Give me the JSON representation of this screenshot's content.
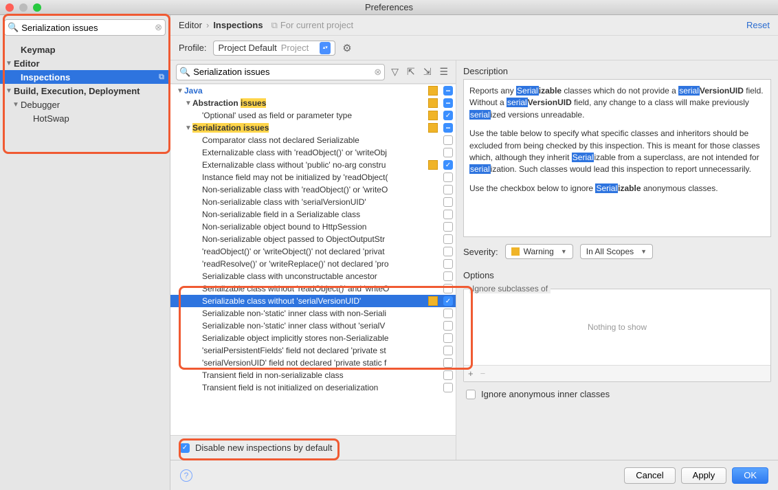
{
  "window": {
    "title": "Preferences"
  },
  "sidebar": {
    "search_value": "Serialization issues",
    "items": [
      {
        "label": "Keymap",
        "kind": "item",
        "level": 1,
        "bold": true
      },
      {
        "label": "Editor",
        "kind": "parent",
        "level": 0,
        "bold": true
      },
      {
        "label": "Inspections",
        "kind": "item",
        "level": 1,
        "bold": true,
        "selected": true
      },
      {
        "label": "Build, Execution, Deployment",
        "kind": "parent",
        "level": 0,
        "bold": true
      },
      {
        "label": "Debugger",
        "kind": "parent",
        "level": 1
      },
      {
        "label": "HotSwap",
        "kind": "item",
        "level": 2
      }
    ]
  },
  "breadcrumb": {
    "a": "Editor",
    "b": "Inspections",
    "note": "For current project",
    "reset": "Reset"
  },
  "profile": {
    "label": "Profile:",
    "value": "Project Default",
    "grey": "Project"
  },
  "tree": {
    "search_value": "Serialization issues",
    "rows": [
      {
        "label": "Java",
        "lvl": 0,
        "arrow": "down",
        "bold": true,
        "blue": true,
        "sev": true,
        "cb": "minus"
      },
      {
        "pre": "Abstraction ",
        "hl": "issues",
        "lvl": 1,
        "arrow": "down",
        "bold": true,
        "sev": true,
        "cb": "minus"
      },
      {
        "label": "'Optional' used as field or parameter type",
        "lvl": 2,
        "sev": true,
        "cb": "checked"
      },
      {
        "pre": "",
        "hl": "Serialization issues",
        "lvl": 1,
        "arrow": "down",
        "bold": true,
        "sev": true,
        "cb": "minus"
      },
      {
        "label": "Comparator class not declared Serializable",
        "lvl": 2,
        "cb": "empty"
      },
      {
        "label": "Externalizable class with 'readObject()' or 'writeObj",
        "lvl": 2,
        "cb": "empty"
      },
      {
        "label": "Externalizable class without 'public' no-arg constru",
        "lvl": 2,
        "sev": true,
        "cb": "checked"
      },
      {
        "label": "Instance field may not be initialized by 'readObject(",
        "lvl": 2,
        "cb": "empty"
      },
      {
        "label": "Non-serializable class with 'readObject()' or 'writeO",
        "lvl": 2,
        "cb": "empty"
      },
      {
        "label": "Non-serializable class with 'serialVersionUID'",
        "lvl": 2,
        "cb": "empty"
      },
      {
        "label": "Non-serializable field in a Serializable class",
        "lvl": 2,
        "cb": "empty"
      },
      {
        "label": "Non-serializable object bound to HttpSession",
        "lvl": 2,
        "cb": "empty"
      },
      {
        "label": "Non-serializable object passed to ObjectOutputStr",
        "lvl": 2,
        "cb": "empty"
      },
      {
        "label": "'readObject()' or 'writeObject()' not declared 'privat",
        "lvl": 2,
        "cb": "empty"
      },
      {
        "label": "'readResolve()' or 'writeReplace()' not declared 'pro",
        "lvl": 2,
        "cb": "empty"
      },
      {
        "label": "Serializable class with unconstructable ancestor",
        "lvl": 2,
        "cb": "empty"
      },
      {
        "label": "Serializable class without 'readObject()' and 'writeO",
        "lvl": 2,
        "cb": "empty"
      },
      {
        "label": "Serializable class without 'serialVersionUID'",
        "lvl": 2,
        "sev": true,
        "cb": "checked",
        "selected": true
      },
      {
        "label": "Serializable non-'static' inner class with non-Seriali",
        "lvl": 2,
        "cb": "empty"
      },
      {
        "label": "Serializable non-'static' inner class without 'serialV",
        "lvl": 2,
        "cb": "empty"
      },
      {
        "label": "Serializable object implicitly stores non-Serializable",
        "lvl": 2,
        "cb": "empty"
      },
      {
        "label": "'serialPersistentFields' field not declared 'private st",
        "lvl": 2,
        "cb": "empty"
      },
      {
        "label": "'serialVersionUID' field not declared 'private static f",
        "lvl": 2,
        "cb": "empty"
      },
      {
        "label": "Transient field in non-serializable class",
        "lvl": 2,
        "cb": "empty"
      },
      {
        "label": "Transient field is not initialized on deserialization",
        "lvl": 2,
        "cb": "empty"
      }
    ]
  },
  "disable_label": "Disable new inspections by default",
  "detail": {
    "title": "Description",
    "p1a": "Reports any ",
    "p1b": "izable",
    "p1c": " classes which do not provide a ",
    "p1d": "VersionUID",
    "p1e": " field. Without a ",
    "p1f": "VersionUID",
    "p1g": " field, any change to a class will make previously ",
    "p1h": "ized versions unreadable.",
    "p2a": "Use the table below to specify what specific classes and inheritors should be excluded from being checked by this inspection. This is meant for those classes which, although they inherit ",
    "p2b": "izable from a superclass, are not intended for ",
    "p2c": "ization. Such classes would lead this inspection to report unnecessarily.",
    "p3a": "Use the checkbox below to ignore ",
    "p3b": "izable",
    "p3c": " anonymous classes."
  },
  "severity": {
    "label": "Severity:",
    "value": "Warning",
    "scope": "In All Scopes"
  },
  "options": {
    "title": "Options",
    "fieldset": "Ignore subclasses of",
    "empty": "Nothing to show",
    "ignore": "Ignore anonymous inner classes"
  },
  "footer": {
    "cancel": "Cancel",
    "apply": "Apply",
    "ok": "OK"
  }
}
